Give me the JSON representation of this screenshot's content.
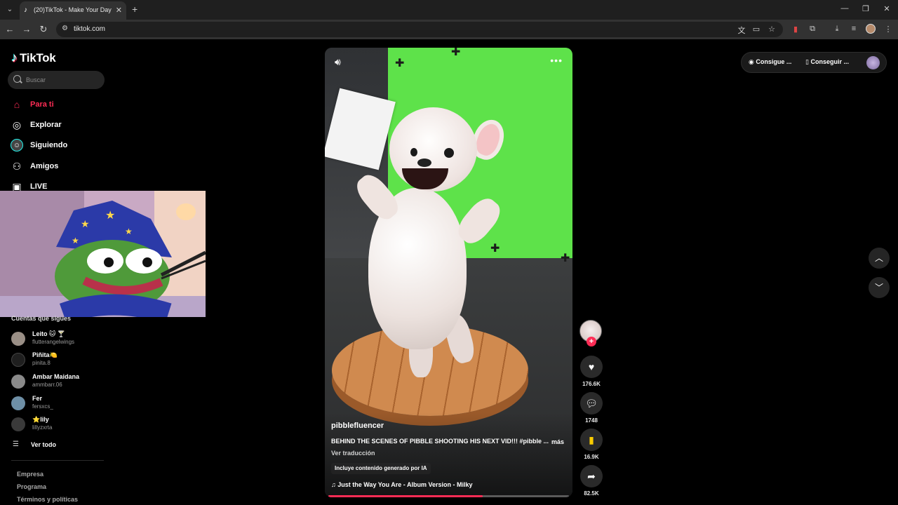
{
  "browser": {
    "tab_title": "(20)TikTok - Make Your Day",
    "url": "tiktok.com",
    "new_tab": "+",
    "close_tab": "✕"
  },
  "sidebar": {
    "logo_text": "TikTok",
    "search_placeholder": "Buscar",
    "nav": [
      {
        "label": "Para ti",
        "icon": "home-icon",
        "active": true
      },
      {
        "label": "Explorar",
        "icon": "compass-icon"
      },
      {
        "label": "Siguiendo",
        "icon": "following-avatar-icon"
      },
      {
        "label": "Amigos",
        "icon": "friends-icon"
      },
      {
        "label": "LIVE",
        "icon": "live-tv-icon"
      }
    ],
    "following_title": "Cuentas que sigues",
    "following": [
      {
        "name": "Leito 🐱 🍸",
        "handle": "flutterangelwings",
        "color": "#9a8f86"
      },
      {
        "name": "Piñita🍋",
        "handle": "pinita.8",
        "color": "#1f1f1f"
      },
      {
        "name": "Ambar Maidana",
        "handle": "ammbarr.06",
        "color": "#8a8a8a"
      },
      {
        "name": "Fer",
        "handle": "fersxcs_",
        "color": "#6e8fa6"
      },
      {
        "name": "⭐lily",
        "handle": "lillyzxrta",
        "color": "#3a3a3a"
      }
    ],
    "see_all": "Ver todo",
    "footer": [
      "Empresa",
      "Programa",
      "Términos y políticas"
    ]
  },
  "video": {
    "author": "pibblefluencer",
    "description": "BEHIND THE SCENES OF PIBBLE SHOOTING HIS NEXT VID!!! #pibble ...",
    "more": "más",
    "translate": "Ver traducción",
    "ai_label": "Incluye contenido generado por IA",
    "music": "Just the Way You Are - Album Version - Milky",
    "progress": 0.64
  },
  "actions": {
    "likes": "176.6K",
    "comments": "1748",
    "saves": "16.9K",
    "shares": "82.5K"
  },
  "top_right": {
    "coins_label": "Consigue ...",
    "app_label": "Conseguir ..."
  },
  "colors": {
    "accent": "#fe2c55",
    "save_active": "#facd00"
  }
}
